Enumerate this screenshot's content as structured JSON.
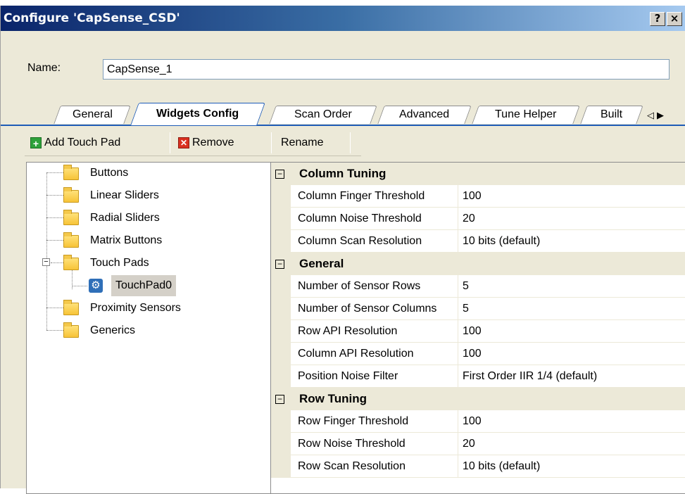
{
  "window": {
    "title": "Configure 'CapSense_CSD'",
    "help_label": "?",
    "close_label": "×"
  },
  "name_field": {
    "label": "Name:",
    "value": "CapSense_1"
  },
  "tabs": [
    {
      "label": "General"
    },
    {
      "label": "Widgets Config",
      "active": true
    },
    {
      "label": "Scan Order"
    },
    {
      "label": "Advanced"
    },
    {
      "label": "Tune Helper"
    },
    {
      "label": "Built"
    }
  ],
  "tab_scroll": {
    "left": "◁",
    "right": "▶"
  },
  "toolbar": {
    "add_label": "Add Touch Pad",
    "add_icon_glyph": "+",
    "remove_label": "Remove",
    "remove_icon_glyph": "✕",
    "rename_label": "Rename"
  },
  "tree": {
    "items": [
      {
        "label": "Buttons"
      },
      {
        "label": "Linear Sliders"
      },
      {
        "label": "Radial Sliders"
      },
      {
        "label": "Matrix Buttons"
      },
      {
        "label": "Touch Pads",
        "expanded": true
      },
      {
        "label": "TouchPad0",
        "selected": true
      },
      {
        "label": "Proximity Sensors"
      },
      {
        "label": "Generics"
      }
    ],
    "expander_glyph": "−",
    "gear_glyph": "⚙"
  },
  "properties": {
    "toggle_glyph": "−",
    "categories": [
      {
        "name": "Column Tuning",
        "rows": [
          {
            "name": "Column Finger Threshold",
            "value": "100"
          },
          {
            "name": "Column Noise Threshold",
            "value": "20"
          },
          {
            "name": "Column Scan Resolution",
            "value": "10 bits (default)"
          }
        ]
      },
      {
        "name": "General",
        "rows": [
          {
            "name": "Number of Sensor Rows",
            "value": "5"
          },
          {
            "name": "Number of Sensor Columns",
            "value": "5"
          },
          {
            "name": "Row API Resolution",
            "value": "100"
          },
          {
            "name": "Column API Resolution",
            "value": "100"
          },
          {
            "name": "Position Noise Filter",
            "value": "First Order IIR 1/4 (default)"
          }
        ]
      },
      {
        "name": "Row Tuning",
        "rows": [
          {
            "name": "Row Finger Threshold",
            "value": "100"
          },
          {
            "name": "Row Noise Threshold",
            "value": "20"
          },
          {
            "name": "Row Scan Resolution",
            "value": "10 bits (default)"
          }
        ]
      }
    ]
  },
  "colors": {
    "title_gradient_start": "#0a246a",
    "title_gradient_end": "#a6caf0",
    "dialog_bg": "#ece9d8",
    "active_tab_border": "#1d5bb7",
    "add_icon": "#2ea13a",
    "remove_icon": "#d9301f",
    "folder": "#f7c338",
    "gear_icon": "#2f6fb8"
  }
}
